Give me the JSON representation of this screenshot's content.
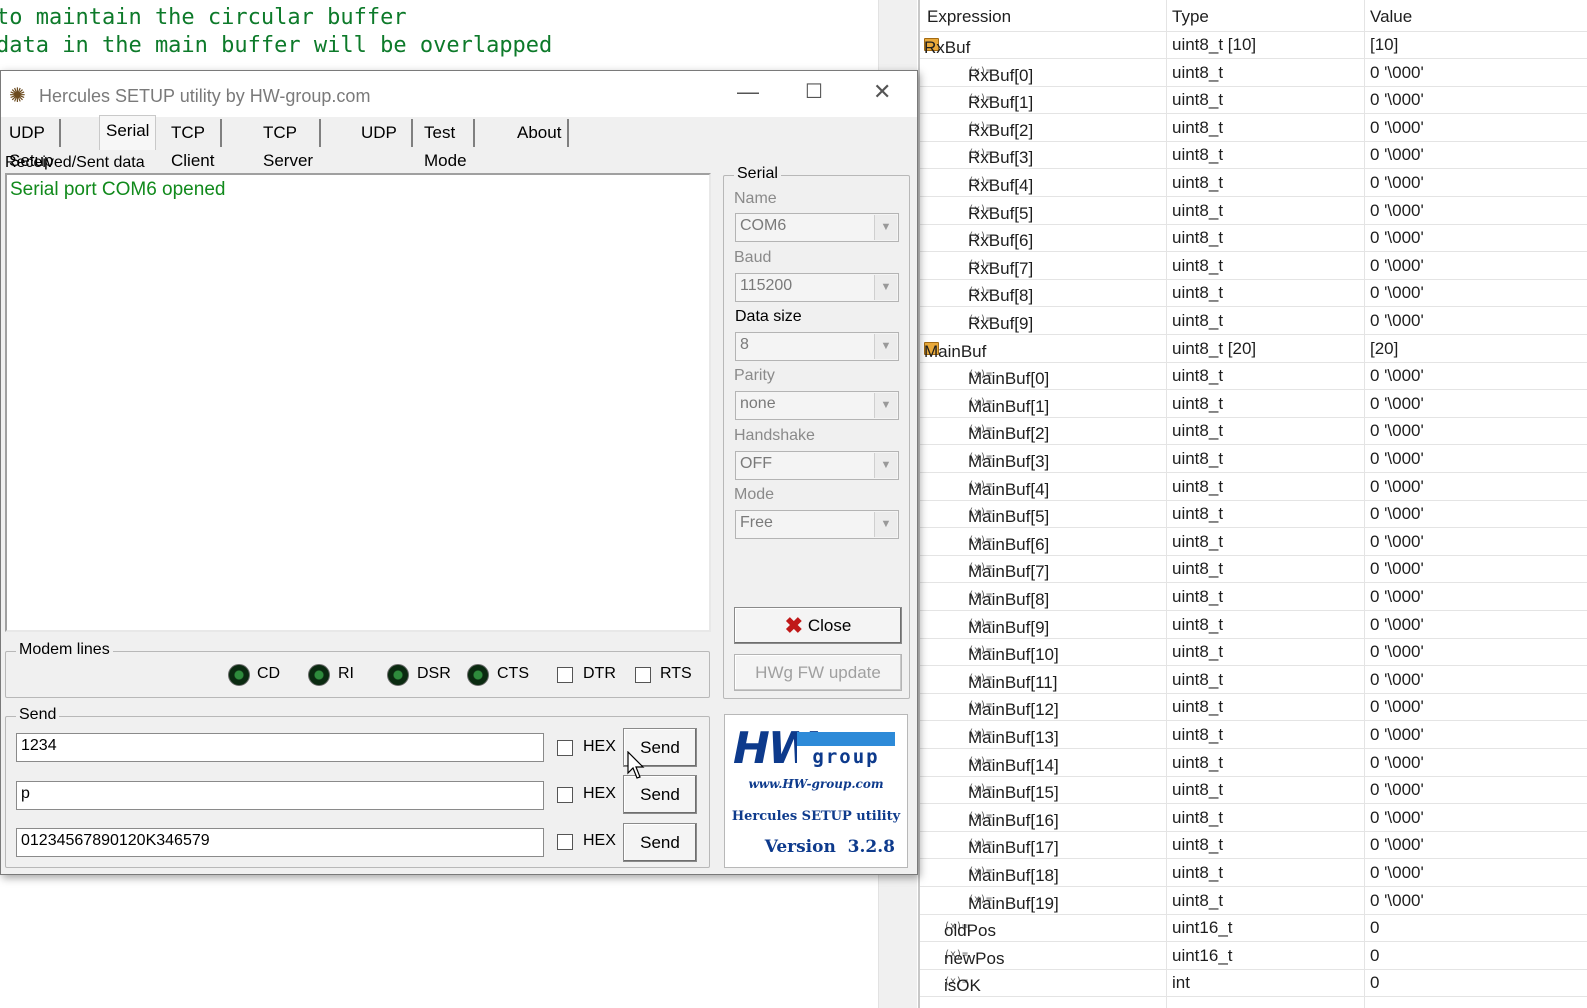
{
  "editor": {
    "lines": [
      "to maintain the circular buffer",
      "data in the main buffer will be overlapped"
    ]
  },
  "hercules": {
    "title": "Hercules SETUP utility by HW-group.com",
    "tabs": [
      "UDP Setup",
      "Serial",
      "TCP Client",
      "TCP Server",
      "UDP",
      "Test Mode",
      "About"
    ],
    "received_label": "Received/Sent data",
    "received_text": "Serial port COM6 opened",
    "serial": {
      "group_title": "Serial",
      "name_label": "Name",
      "name_value": "COM6",
      "baud_label": "Baud",
      "baud_value": "115200",
      "datasize_label": "Data size",
      "datasize_value": "8",
      "parity_label": "Parity",
      "parity_value": "none",
      "handshake_label": "Handshake",
      "handshake_value": "OFF",
      "mode_label": "Mode",
      "mode_value": "Free",
      "close_label": "Close",
      "fw_update_label": "HWg FW update"
    },
    "modem": {
      "group_title": "Modem lines",
      "cd": "CD",
      "ri": "RI",
      "dsr": "DSR",
      "cts": "CTS",
      "dtr": "DTR",
      "rts": "RTS"
    },
    "send": {
      "group_title": "Send",
      "rows": [
        {
          "value": "1234",
          "hex": "HEX",
          "button": "Send"
        },
        {
          "value": "p",
          "hex": "HEX",
          "button": "Send"
        },
        {
          "value": "01234567890120K346579",
          "hex": "HEX",
          "button": "Send"
        }
      ]
    },
    "logo": {
      "brand_left": "HW",
      "brand_right": "group",
      "url": "www.HW-group.com",
      "product": "Hercules SETUP utility",
      "version": "Version  3.2.8"
    }
  },
  "watch": {
    "headers": {
      "expression": "Expression",
      "type": "Type",
      "value": "Value"
    },
    "rows": [
      {
        "name": "RxBuf",
        "type": "uint8_t [10]",
        "value": "[10]",
        "level": 0,
        "kind": "array"
      },
      {
        "name": "RxBuf[0]",
        "type": "uint8_t",
        "value": "0 '\\000'",
        "level": 1,
        "kind": "var"
      },
      {
        "name": "RxBuf[1]",
        "type": "uint8_t",
        "value": "0 '\\000'",
        "level": 1,
        "kind": "var"
      },
      {
        "name": "RxBuf[2]",
        "type": "uint8_t",
        "value": "0 '\\000'",
        "level": 1,
        "kind": "var"
      },
      {
        "name": "RxBuf[3]",
        "type": "uint8_t",
        "value": "0 '\\000'",
        "level": 1,
        "kind": "var"
      },
      {
        "name": "RxBuf[4]",
        "type": "uint8_t",
        "value": "0 '\\000'",
        "level": 1,
        "kind": "var"
      },
      {
        "name": "RxBuf[5]",
        "type": "uint8_t",
        "value": "0 '\\000'",
        "level": 1,
        "kind": "var"
      },
      {
        "name": "RxBuf[6]",
        "type": "uint8_t",
        "value": "0 '\\000'",
        "level": 1,
        "kind": "var"
      },
      {
        "name": "RxBuf[7]",
        "type": "uint8_t",
        "value": "0 '\\000'",
        "level": 1,
        "kind": "var"
      },
      {
        "name": "RxBuf[8]",
        "type": "uint8_t",
        "value": "0 '\\000'",
        "level": 1,
        "kind": "var"
      },
      {
        "name": "RxBuf[9]",
        "type": "uint8_t",
        "value": "0 '\\000'",
        "level": 1,
        "kind": "var"
      },
      {
        "name": "MainBuf",
        "type": "uint8_t [20]",
        "value": "[20]",
        "level": 0,
        "kind": "array"
      },
      {
        "name": "MainBuf[0]",
        "type": "uint8_t",
        "value": "0 '\\000'",
        "level": 1,
        "kind": "var"
      },
      {
        "name": "MainBuf[1]",
        "type": "uint8_t",
        "value": "0 '\\000'",
        "level": 1,
        "kind": "var"
      },
      {
        "name": "MainBuf[2]",
        "type": "uint8_t",
        "value": "0 '\\000'",
        "level": 1,
        "kind": "var"
      },
      {
        "name": "MainBuf[3]",
        "type": "uint8_t",
        "value": "0 '\\000'",
        "level": 1,
        "kind": "var"
      },
      {
        "name": "MainBuf[4]",
        "type": "uint8_t",
        "value": "0 '\\000'",
        "level": 1,
        "kind": "var"
      },
      {
        "name": "MainBuf[5]",
        "type": "uint8_t",
        "value": "0 '\\000'",
        "level": 1,
        "kind": "var"
      },
      {
        "name": "MainBuf[6]",
        "type": "uint8_t",
        "value": "0 '\\000'",
        "level": 1,
        "kind": "var"
      },
      {
        "name": "MainBuf[7]",
        "type": "uint8_t",
        "value": "0 '\\000'",
        "level": 1,
        "kind": "var"
      },
      {
        "name": "MainBuf[8]",
        "type": "uint8_t",
        "value": "0 '\\000'",
        "level": 1,
        "kind": "var"
      },
      {
        "name": "MainBuf[9]",
        "type": "uint8_t",
        "value": "0 '\\000'",
        "level": 1,
        "kind": "var"
      },
      {
        "name": "MainBuf[10]",
        "type": "uint8_t",
        "value": "0 '\\000'",
        "level": 1,
        "kind": "var"
      },
      {
        "name": "MainBuf[11]",
        "type": "uint8_t",
        "value": "0 '\\000'",
        "level": 1,
        "kind": "var"
      },
      {
        "name": "MainBuf[12]",
        "type": "uint8_t",
        "value": "0 '\\000'",
        "level": 1,
        "kind": "var"
      },
      {
        "name": "MainBuf[13]",
        "type": "uint8_t",
        "value": "0 '\\000'",
        "level": 1,
        "kind": "var"
      },
      {
        "name": "MainBuf[14]",
        "type": "uint8_t",
        "value": "0 '\\000'",
        "level": 1,
        "kind": "var"
      },
      {
        "name": "MainBuf[15]",
        "type": "uint8_t",
        "value": "0 '\\000'",
        "level": 1,
        "kind": "var"
      },
      {
        "name": "MainBuf[16]",
        "type": "uint8_t",
        "value": "0 '\\000'",
        "level": 1,
        "kind": "var"
      },
      {
        "name": "MainBuf[17]",
        "type": "uint8_t",
        "value": "0 '\\000'",
        "level": 1,
        "kind": "var"
      },
      {
        "name": "MainBuf[18]",
        "type": "uint8_t",
        "value": "0 '\\000'",
        "level": 1,
        "kind": "var"
      },
      {
        "name": "MainBuf[19]",
        "type": "uint8_t",
        "value": "0 '\\000'",
        "level": 1,
        "kind": "var"
      },
      {
        "name": "oldPos",
        "type": "uint16_t",
        "value": "0",
        "level": 0,
        "kind": "var"
      },
      {
        "name": "newPos",
        "type": "uint16_t",
        "value": "0",
        "level": 0,
        "kind": "var"
      },
      {
        "name": "isOK",
        "type": "int",
        "value": "0",
        "level": 0,
        "kind": "var"
      }
    ]
  },
  "icons": {
    "variable": "variable-icon",
    "array": "array-folder-icon",
    "expander": "chevron-down-icon",
    "close_x": "close-x-icon",
    "app": "hercules-app-icon"
  },
  "colors": {
    "code_text": "#0d7a2a",
    "received_text": "#118a1c",
    "logo_blue": "#0d3a8c",
    "close_x": "#c01818"
  }
}
